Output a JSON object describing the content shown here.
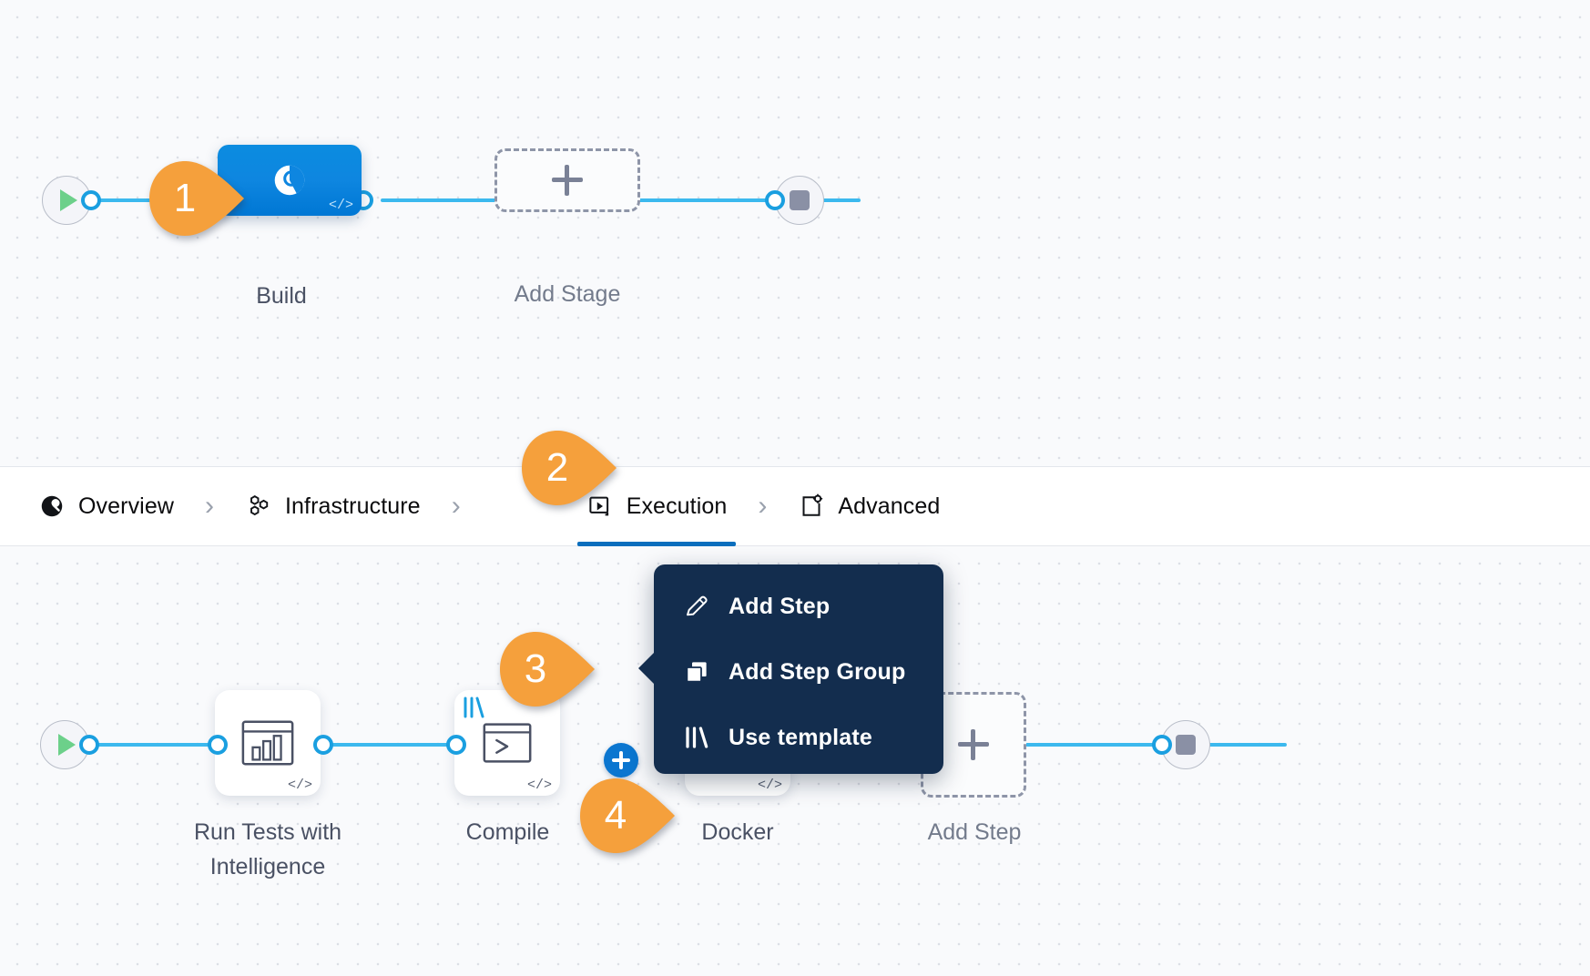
{
  "theme": {
    "accent_blue": "#0b76d0",
    "edge_blue": "#3cb9ee",
    "callout_orange": "#F5A03C",
    "menu_navy": "#132d4e",
    "canvas_bg": "#f9fafc",
    "active_tab_underline": "#0a6ebd"
  },
  "stage_graph": {
    "start_node": "play-icon",
    "end_node": "stop-icon",
    "stage": {
      "label": "Build",
      "icon": "ci-build-icon",
      "code_badge": "</>"
    },
    "add_stage": {
      "label": "Add Stage",
      "icon": "plus-icon"
    }
  },
  "tabs": {
    "separator": "›",
    "items": [
      {
        "label": "Overview",
        "icon": "overview-icon",
        "active": false
      },
      {
        "label": "Infrastructure",
        "icon": "infrastructure-icon",
        "active": false
      },
      {
        "label": "Execution",
        "icon": "execution-icon",
        "active": true
      },
      {
        "label": "Advanced",
        "icon": "advanced-icon",
        "active": false
      }
    ]
  },
  "step_graph": {
    "start_node": "play-icon",
    "end_node": "stop-icon",
    "steps": [
      {
        "label": "Run Tests with\nIntelligence",
        "icon": "test-report-chart-icon",
        "code_badge": "</>",
        "templated": false
      },
      {
        "label": "Compile",
        "icon": "terminal-prompt-icon",
        "code_badge": "</>",
        "templated": true
      },
      {
        "label": "Docker",
        "icon": "docker-icon",
        "code_badge": "</>",
        "templated": false
      }
    ],
    "add_step": {
      "label": "Add Step",
      "icon": "plus-icon"
    },
    "add_between_button": {
      "icon": "plus-icon"
    }
  },
  "context_menu": {
    "items": [
      {
        "label": "Add Step",
        "icon": "pencil-icon"
      },
      {
        "label": "Add Step Group",
        "icon": "copy-layers-icon"
      },
      {
        "label": "Use template",
        "icon": "template-bars-icon"
      }
    ]
  },
  "callouts": [
    {
      "number": "1"
    },
    {
      "number": "2"
    },
    {
      "number": "3"
    },
    {
      "number": "4"
    }
  ]
}
